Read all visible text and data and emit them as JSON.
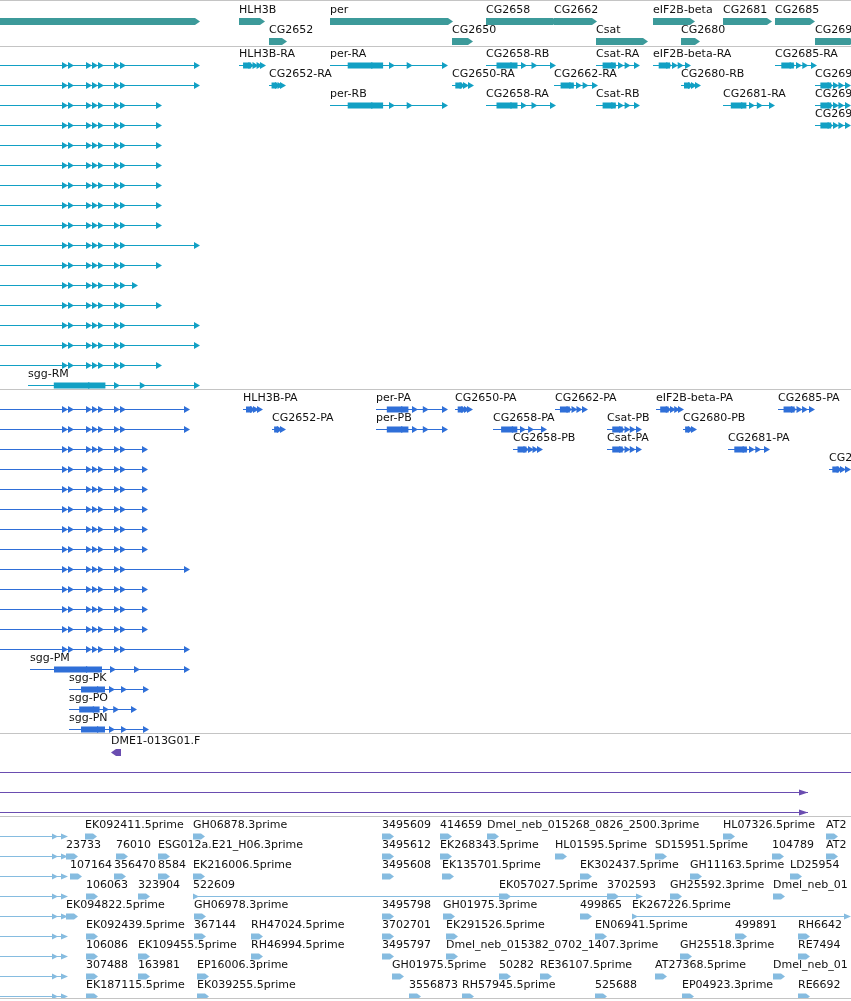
{
  "tracks": [
    {
      "kind": "gene",
      "color": "#3c9a9a",
      "rows": [
        {
          "lead": true,
          "features": [
            "HLH3B",
            "per",
            "CG2658",
            "CG2662",
            "eIF2B-beta",
            "CG2681",
            "CG2685"
          ]
        },
        {
          "lead": false,
          "features": [
            "CG2652",
            "CG2650",
            "Csat",
            "CG2680",
            "CG269"
          ]
        }
      ]
    },
    {
      "kind": "transcript",
      "color": "#12a0c4",
      "rows": [
        {
          "lead": true,
          "features": [
            "HLH3B-RA",
            "per-RA",
            "CG2658-RB",
            "Csat-RA",
            "eIF2B-beta-RA",
            "CG2685-RA"
          ]
        },
        {
          "lead": true,
          "features": [
            "CG2652-RA",
            "CG2650-RA",
            "CG2662-RA",
            "CG2680-RB",
            "CG269"
          ]
        },
        {
          "lead": true,
          "features": [
            "per-RB",
            "CG2658-RA",
            "Csat-RB",
            "CG2681-RA",
            "CG269"
          ]
        },
        {
          "lead": true,
          "features": [
            "CG269"
          ]
        },
        {
          "lead": true
        },
        {
          "lead": true
        },
        {
          "lead": true
        },
        {
          "lead": true
        },
        {
          "lead": true
        },
        {
          "lead": true
        },
        {
          "lead": true
        },
        {
          "lead": true
        },
        {
          "lead": true
        },
        {
          "lead": true
        },
        {
          "lead": true
        },
        {
          "lead": true
        },
        {
          "lead": false,
          "features": [
            "sgg-RM"
          ]
        }
      ]
    },
    {
      "kind": "transcript",
      "color": "#2f6fd8",
      "rows": [
        {
          "lead": true,
          "features": [
            "HLH3B-PA",
            "per-PA",
            "CG2650-PA",
            "CG2662-PA",
            "eIF2B-beta-PA",
            "CG2685-PA"
          ]
        },
        {
          "lead": true,
          "features": [
            "CG2652-PA",
            "per-PB",
            "CG2658-PA",
            "Csat-PB",
            "CG2680-PB"
          ]
        },
        {
          "lead": true,
          "features": [
            "CG2658-PB",
            "Csat-PA",
            "CG2681-PA"
          ]
        },
        {
          "lead": true,
          "features": [
            "CG2"
          ]
        },
        {
          "lead": true
        },
        {
          "lead": true
        },
        {
          "lead": true
        },
        {
          "lead": true
        },
        {
          "lead": true
        },
        {
          "lead": true
        },
        {
          "lead": true
        },
        {
          "lead": true
        },
        {
          "lead": true
        },
        {
          "lead": false,
          "features": [
            "sgg-PM"
          ]
        },
        {
          "lead": false,
          "features": [
            "sgg-PK"
          ]
        },
        {
          "lead": false,
          "features": [
            "sgg-PO"
          ]
        },
        {
          "lead": false,
          "features": [
            "sgg-PN"
          ]
        }
      ]
    },
    {
      "kind": "contig",
      "color": "#6a4db0",
      "rows": [
        {
          "lead": false,
          "features": [
            "DME1-013G01.F"
          ]
        },
        {
          "lead": true
        },
        {
          "lead": true
        },
        {
          "lead": true
        }
      ]
    },
    {
      "kind": "est",
      "color": "#86bce0",
      "rows": [
        {
          "lead": true,
          "features": [
            "EK092411.5prime",
            "GH06878.3prime",
            "3495609",
            "414659",
            "Dmel_neb_015268_0826_2500.3prime",
            "HL07326.5prime",
            "AT2"
          ]
        },
        {
          "lead": true,
          "features": [
            "23733",
            "76010",
            "ESG012a.E21_H06.3prime",
            "3495612",
            "EK268343.5prime",
            "HL01595.5prime",
            "SD15951.5prime",
            "104789",
            "AT2"
          ]
        },
        {
          "lead": true,
          "features": [
            "107164",
            "356470",
            "8584",
            "EK216006.5prime",
            "3495608",
            "EK135701.5prime",
            "EK302437.5prime",
            "GH11163.5prime",
            "LD25954"
          ]
        },
        {
          "lead": true,
          "features": [
            "106063",
            "323904",
            "522609",
            "EK057027.5prime",
            "3702593",
            "GH25592.3prime",
            "Dmel_neb_01"
          ]
        },
        {
          "lead": true,
          "features": [
            "EK094822.5prime",
            "GH06978.3prime",
            "3495798",
            "GH01975.3prime",
            "499865",
            "EK267226.5prime"
          ]
        },
        {
          "lead": true,
          "features": [
            "EK092439.5prime",
            "367144",
            "RH47024.5prime",
            "3702701",
            "EK291526.5prime",
            "EN06941.5prime",
            "499891",
            "RH6642"
          ]
        },
        {
          "lead": true,
          "features": [
            "106086",
            "EK109455.5prime",
            "RH46994.5prime",
            "3495797",
            "Dmel_neb_015382_0702_1407.3prime",
            "GH25518.3prime",
            "RE7494"
          ]
        },
        {
          "lead": true,
          "features": [
            "307488",
            "163981",
            "EP16006.3prime",
            "GH01975.5prime",
            "50282",
            "RE36107.5prime",
            "AT27368.5prime",
            "Dmel_neb_01"
          ]
        },
        {
          "lead": true,
          "features": [
            "EK187115.5prime",
            "EK039255.5prime",
            "3556873",
            "RH57945.5prime",
            "525688",
            "EP04923.3prime",
            "RE6692"
          ]
        }
      ]
    }
  ]
}
